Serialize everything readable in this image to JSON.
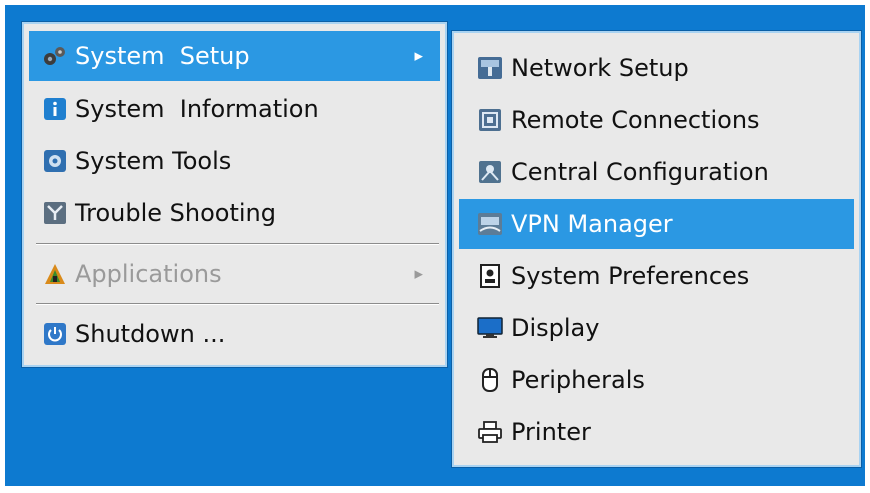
{
  "main_menu": {
    "items": [
      {
        "label": "System  Setup",
        "icon": "gears-icon"
      },
      {
        "label": "System  Information",
        "icon": "info-icon"
      },
      {
        "label": "System Tools",
        "icon": "tools-icon"
      },
      {
        "label": "Trouble Shooting",
        "icon": "troubleshoot-icon"
      },
      {
        "label": "Applications",
        "icon": "applications-icon"
      },
      {
        "label": "Shutdown ...",
        "icon": "power-icon"
      }
    ]
  },
  "sub_menu": {
    "items": [
      {
        "label": "Network Setup",
        "icon": "network-icon"
      },
      {
        "label": "Remote Connections",
        "icon": "remote-connections-icon"
      },
      {
        "label": "Central Configuration",
        "icon": "central-config-icon"
      },
      {
        "label": "VPN Manager",
        "icon": "vpn-icon"
      },
      {
        "label": "System Preferences",
        "icon": "preferences-icon"
      },
      {
        "label": "Display",
        "icon": "monitor-icon"
      },
      {
        "label": "Peripherals",
        "icon": "mouse-icon"
      },
      {
        "label": "Printer",
        "icon": "printer-icon"
      }
    ]
  },
  "colors": {
    "desktop": "#0d7ad0",
    "menu_bg": "#e9e9e9",
    "highlight": "#2b98e3",
    "disabled_text": "#9a9a9a"
  }
}
